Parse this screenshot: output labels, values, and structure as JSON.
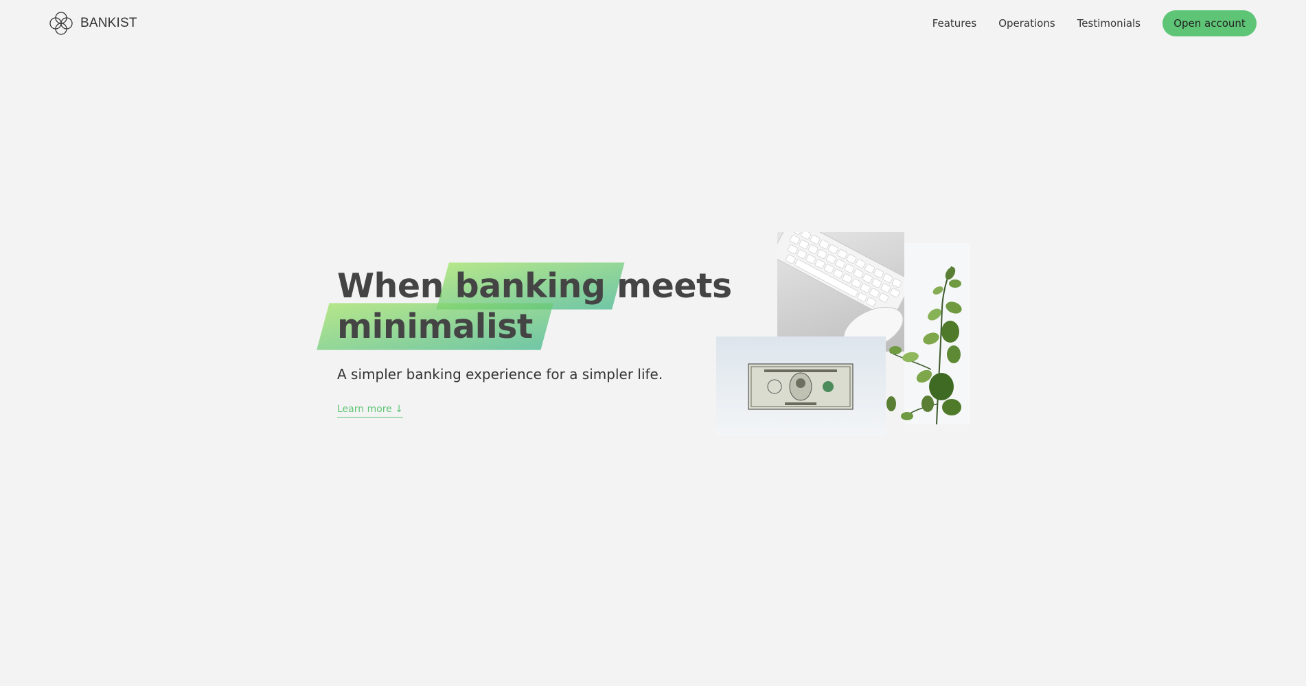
{
  "brand": {
    "name": "BANKIST"
  },
  "nav": {
    "links": [
      "Features",
      "Operations",
      "Testimonials"
    ],
    "cta_label": "Open account"
  },
  "hero": {
    "title_part1": "When",
    "title_highlight1": "banking",
    "title_part2": "meets",
    "title_highlight2": "minimalist",
    "subtitle": "A simpler banking experience for a simpler life.",
    "learn_more": "Learn more ↓"
  },
  "colors": {
    "background": "#f3f3f3",
    "accent": "#5ec576",
    "gradient_start": "#9be15d",
    "gradient_end": "#39b385",
    "text": "#444444"
  },
  "icons": {
    "logo": "bankist-logo-icon"
  }
}
